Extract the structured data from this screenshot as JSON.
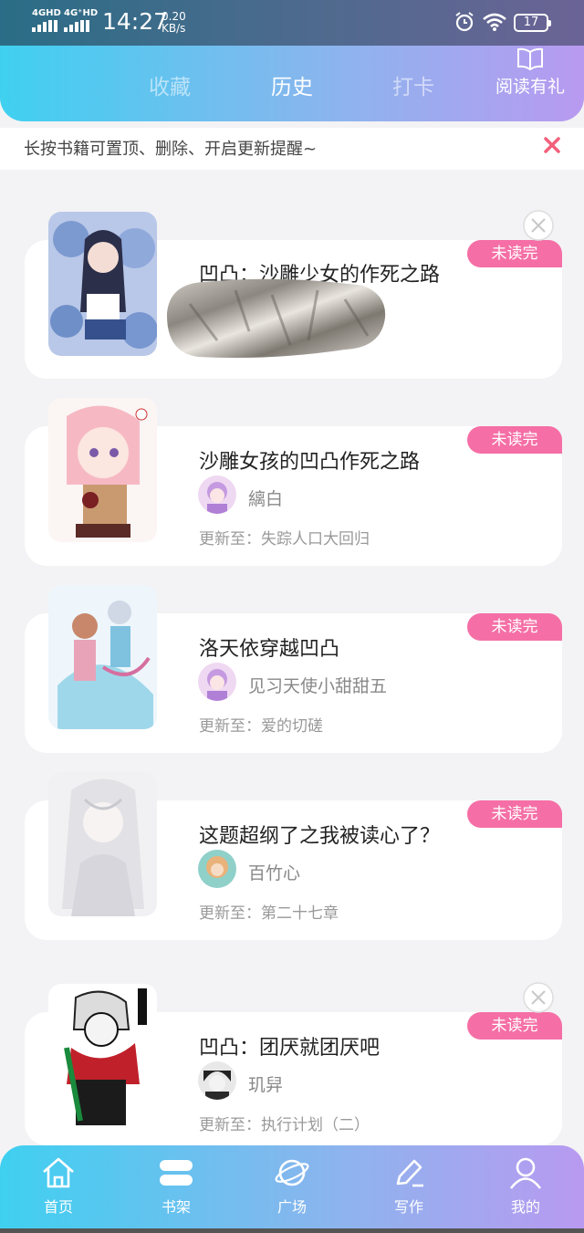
{
  "status_bar": {
    "signal1": "4GHD",
    "signal2": "4G⁺HD",
    "time": "14:27",
    "speed_value": "0.20",
    "speed_unit": "KB/s",
    "battery": "17"
  },
  "header": {
    "tabs": [
      {
        "label": "收藏",
        "active": false
      },
      {
        "label": "历史",
        "active": true
      },
      {
        "label": "打卡",
        "active": false
      }
    ],
    "reward_label": "阅读有礼"
  },
  "tip": {
    "text": "长按书籍可置顶、删除、开启更新提醒~"
  },
  "books": [
    {
      "title": "凹凸：沙雕少女的作死之路",
      "badge": "未读完",
      "author": "",
      "update": ""
    },
    {
      "title": "沙雕女孩的凹凸作死之路",
      "badge": "未读完",
      "author": "縭白",
      "update": "更新至：失踪人口大回归"
    },
    {
      "title": "洛天依穿越凹凸",
      "badge": "未读完",
      "author": "见习天使小甜甜五",
      "update": "更新至：爱的切磋"
    },
    {
      "title": "这题超纲了之我被读心了？",
      "badge": "未读完",
      "author": "百竹心",
      "update": "更新至：第二十七章"
    },
    {
      "title": "凹凸：团厌就团厌吧",
      "badge": "未读完",
      "author": "玑舁",
      "update": "更新至：执行计划（二）"
    }
  ],
  "nav": [
    {
      "label": "首页",
      "icon": "home-icon"
    },
    {
      "label": "书架",
      "icon": "bookshelf-icon",
      "active": true
    },
    {
      "label": "广场",
      "icon": "planet-icon"
    },
    {
      "label": "写作",
      "icon": "pen-icon"
    },
    {
      "label": "我的",
      "icon": "user-icon"
    }
  ],
  "colors": {
    "header_start": "#3fd0f0",
    "header_end": "#b89af0",
    "badge": "#f56fa6",
    "close_x": "#f2607a"
  }
}
